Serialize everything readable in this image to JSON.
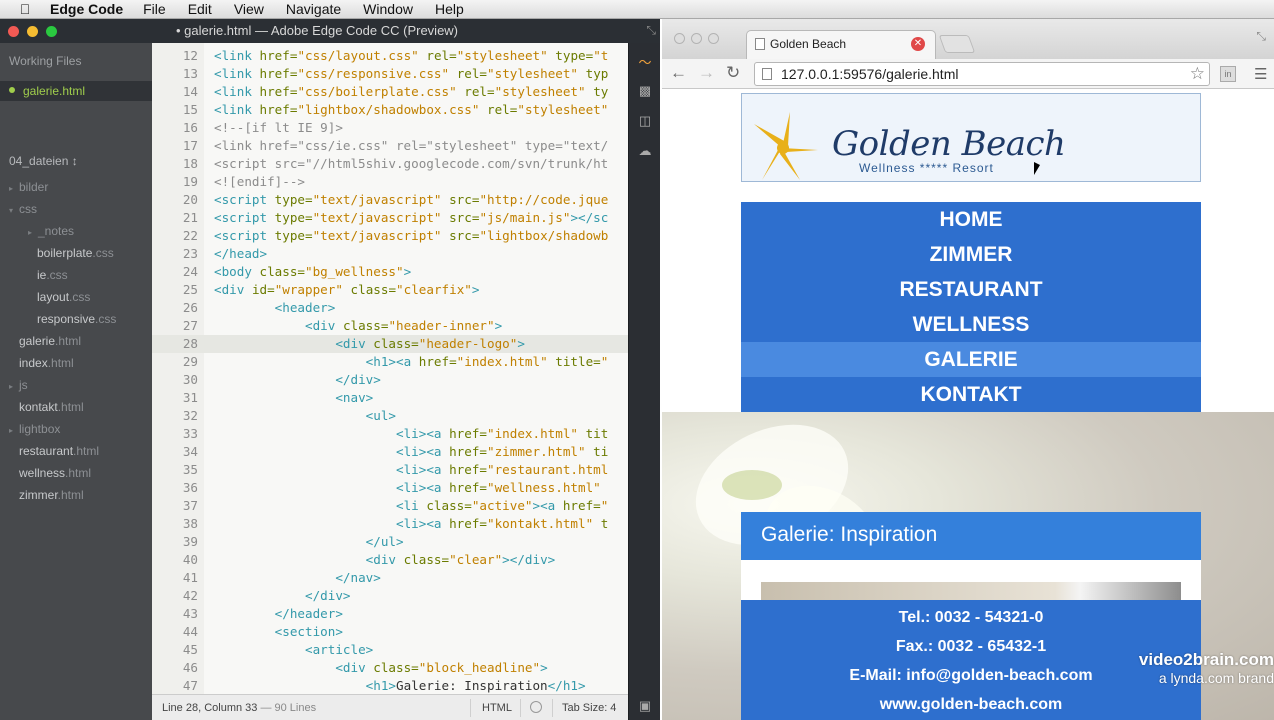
{
  "menubar": {
    "app_name": "Edge Code",
    "items": [
      "File",
      "Edit",
      "View",
      "Navigate",
      "Window",
      "Help"
    ]
  },
  "editor": {
    "title": "• galerie.html — Adobe Edge Code CC (Preview)",
    "working_files_label": "Working Files",
    "working_file": "galerie.html",
    "project_label": "04_dateien ↕",
    "tree": [
      {
        "name": "bilder",
        "ext": "",
        "type": "folder",
        "indent": 0
      },
      {
        "name": "css",
        "ext": "",
        "type": "folder-open",
        "indent": 0
      },
      {
        "name": "_notes",
        "ext": "",
        "type": "folder",
        "indent": 1
      },
      {
        "name": "boilerplate",
        "ext": ".css",
        "type": "file",
        "indent": 2
      },
      {
        "name": "ie",
        "ext": ".css",
        "type": "file",
        "indent": 2
      },
      {
        "name": "layout",
        "ext": ".css",
        "type": "file",
        "indent": 2
      },
      {
        "name": "responsive",
        "ext": ".css",
        "type": "file",
        "indent": 2
      },
      {
        "name": "galerie",
        "ext": ".html",
        "type": "file",
        "indent": 1
      },
      {
        "name": "index",
        "ext": ".html",
        "type": "file",
        "indent": 1
      },
      {
        "name": "js",
        "ext": "",
        "type": "folder",
        "indent": 0
      },
      {
        "name": "kontakt",
        "ext": ".html",
        "type": "file",
        "indent": 1
      },
      {
        "name": "lightbox",
        "ext": "",
        "type": "folder",
        "indent": 0
      },
      {
        "name": "restaurant",
        "ext": ".html",
        "type": "file",
        "indent": 1
      },
      {
        "name": "wellness",
        "ext": ".html",
        "type": "file",
        "indent": 1
      },
      {
        "name": "zimmer",
        "ext": ".html",
        "type": "file",
        "indent": 1
      }
    ],
    "active_line": 28,
    "code_lines": [
      {
        "n": 12,
        "html": "<span class='tag'>&lt;link</span> <span class='attr'>href=</span><span class='str'>\"css/layout.css\"</span> <span class='attr'>rel=</span><span class='str'>\"stylesheet\"</span> <span class='attr'>type=</span><span class='str'>\"t</span>"
      },
      {
        "n": 13,
        "html": "<span class='tag'>&lt;link</span> <span class='attr'>href=</span><span class='str'>\"css/responsive.css\"</span> <span class='attr'>rel=</span><span class='str'>\"stylesheet\"</span> <span class='attr'>typ</span>"
      },
      {
        "n": 14,
        "html": "<span class='tag'>&lt;link</span> <span class='attr'>href=</span><span class='str'>\"css/boilerplate.css\"</span> <span class='attr'>rel=</span><span class='str'>\"stylesheet\"</span> <span class='attr'>ty</span>"
      },
      {
        "n": 15,
        "html": "<span class='tag'>&lt;link</span> <span class='attr'>href=</span><span class='str'>\"lightbox/shadowbox.css\"</span> <span class='attr'>rel=</span><span class='str'>\"stylesheet\"</span>"
      },
      {
        "n": 16,
        "html": "<span class='cmt'>&lt;!--[if lt IE 9]&gt;</span>"
      },
      {
        "n": 17,
        "html": "<span class='cmt'>&lt;link href=\"css/ie.css\" rel=\"stylesheet\" type=\"text/</span>"
      },
      {
        "n": 18,
        "html": "<span class='cmt'>&lt;script src=\"//html5shiv.googlecode.com/svn/trunk/ht</span>"
      },
      {
        "n": 19,
        "html": "<span class='cmt'>&lt;![endif]--&gt;</span>"
      },
      {
        "n": 20,
        "html": "<span class='tag'>&lt;script</span> <span class='attr'>type=</span><span class='str'>\"text/javascript\"</span> <span class='attr'>src=</span><span class='str'>\"http://code.jque</span>"
      },
      {
        "n": 21,
        "html": "<span class='tag'>&lt;script</span> <span class='attr'>type=</span><span class='str'>\"text/javascript\"</span> <span class='attr'>src=</span><span class='str'>\"js/main.js\"</span><span class='tag'>&gt;&lt;/sc</span>"
      },
      {
        "n": 22,
        "html": "<span class='tag'>&lt;script</span> <span class='attr'>type=</span><span class='str'>\"text/javascript\"</span> <span class='attr'>src=</span><span class='str'>\"lightbox/shadowb</span>"
      },
      {
        "n": 23,
        "html": "<span class='tag'>&lt;/head&gt;</span>"
      },
      {
        "n": 24,
        "html": "<span class='tag'>&lt;body</span> <span class='attr'>class=</span><span class='str'>\"bg_wellness\"</span><span class='tag'>&gt;</span>"
      },
      {
        "n": 25,
        "html": "<span class='tag'>&lt;div</span> <span class='attr'>id=</span><span class='str'>\"wrapper\"</span> <span class='attr'>class=</span><span class='str'>\"clearfix\"</span><span class='tag'>&gt;</span>"
      },
      {
        "n": 26,
        "html": "        <span class='tag'>&lt;header&gt;</span>"
      },
      {
        "n": 27,
        "html": "            <span class='tag'>&lt;div</span> <span class='attr'>class=</span><span class='str'>\"header-inner\"</span><span class='tag'>&gt;</span>"
      },
      {
        "n": 28,
        "html": "                <span class='tag'>&lt;div</span> <span class='attr'>class=</span><span class='str'>\"header-logo\"</span><span class='tag'>&gt;</span>"
      },
      {
        "n": 29,
        "html": "                    <span class='tag'>&lt;h1&gt;&lt;a</span> <span class='attr'>href=</span><span class='str'>\"index.html\"</span> <span class='attr'>title=</span><span class='str'>\"</span>"
      },
      {
        "n": 30,
        "html": "                <span class='tag'>&lt;/div&gt;</span>"
      },
      {
        "n": 31,
        "html": "                <span class='tag'>&lt;nav&gt;</span>"
      },
      {
        "n": 32,
        "html": "                    <span class='tag'>&lt;ul&gt;</span>"
      },
      {
        "n": 33,
        "html": "                        <span class='tag'>&lt;li&gt;&lt;a</span> <span class='attr'>href=</span><span class='str'>\"index.html\"</span> <span class='attr'>tit</span>"
      },
      {
        "n": 34,
        "html": "                        <span class='tag'>&lt;li&gt;&lt;a</span> <span class='attr'>href=</span><span class='str'>\"zimmer.html\"</span> <span class='attr'>ti</span>"
      },
      {
        "n": 35,
        "html": "                        <span class='tag'>&lt;li&gt;&lt;a</span> <span class='attr'>href=</span><span class='str'>\"restaurant.html</span>"
      },
      {
        "n": 36,
        "html": "                        <span class='tag'>&lt;li&gt;&lt;a</span> <span class='attr'>href=</span><span class='str'>\"wellness.html\"</span>"
      },
      {
        "n": 37,
        "html": "                        <span class='tag'>&lt;li</span> <span class='attr'>class=</span><span class='str'>\"active\"</span><span class='tag'>&gt;&lt;a</span> <span class='attr'>href=</span><span class='str'>\"</span>"
      },
      {
        "n": 38,
        "html": "                        <span class='tag'>&lt;li&gt;&lt;a</span> <span class='attr'>href=</span><span class='str'>\"kontakt.html\"</span> <span class='attr'>t</span>"
      },
      {
        "n": 39,
        "html": "                    <span class='tag'>&lt;/ul&gt;</span>"
      },
      {
        "n": 40,
        "html": "                    <span class='tag'>&lt;div</span> <span class='attr'>class=</span><span class='str'>\"clear\"</span><span class='tag'>&gt;&lt;/div&gt;</span>"
      },
      {
        "n": 41,
        "html": "                <span class='tag'>&lt;/nav&gt;</span>"
      },
      {
        "n": 42,
        "html": "            <span class='tag'>&lt;/div&gt;</span>"
      },
      {
        "n": 43,
        "html": "        <span class='tag'>&lt;/header&gt;</span>"
      },
      {
        "n": 44,
        "html": "        <span class='tag'>&lt;section&gt;</span>"
      },
      {
        "n": 45,
        "html": "            <span class='tag'>&lt;article&gt;</span>"
      },
      {
        "n": 46,
        "html": "                <span class='tag'>&lt;div</span> <span class='attr'>class=</span><span class='str'>\"block_headline\"</span><span class='tag'>&gt;</span>"
      },
      {
        "n": 47,
        "html": "                    <span class='tag'>&lt;h1&gt;</span><span class='txt'>Galerie: Inspiration</span><span class='tag'>&lt;/h1&gt;</span>"
      }
    ],
    "status": {
      "position": "Line 28, Column 33",
      "lines": " — 90 Lines",
      "language": "HTML",
      "tab_size": "Tab Size:  4"
    }
  },
  "browser": {
    "tab_title": "Golden Beach",
    "url": "127.0.0.1:59576/galerie.html",
    "site": {
      "logo_title": "Golden Beach",
      "logo_subtitle": "Wellness ***** Resort",
      "nav": [
        "HOME",
        "ZIMMER",
        "RESTAURANT",
        "WELLNESS",
        "GALERIE",
        "KONTAKT"
      ],
      "active_nav": "GALERIE",
      "gallery_title": "Galerie: Inspiration",
      "contact": [
        "Tel.: 0032 - 54321-0",
        "Fax.: 0032 - 65432-1",
        "E-Mail: info@golden-beach.com",
        "www.golden-beach.com"
      ]
    }
  },
  "watermark": {
    "line1": "video2brain.com",
    "line2": "a lynda.com brand"
  },
  "colors": {
    "accent_green": "#a0ce4c",
    "nav_blue": "#2e6fce",
    "active_blue": "#4a8ae0"
  }
}
